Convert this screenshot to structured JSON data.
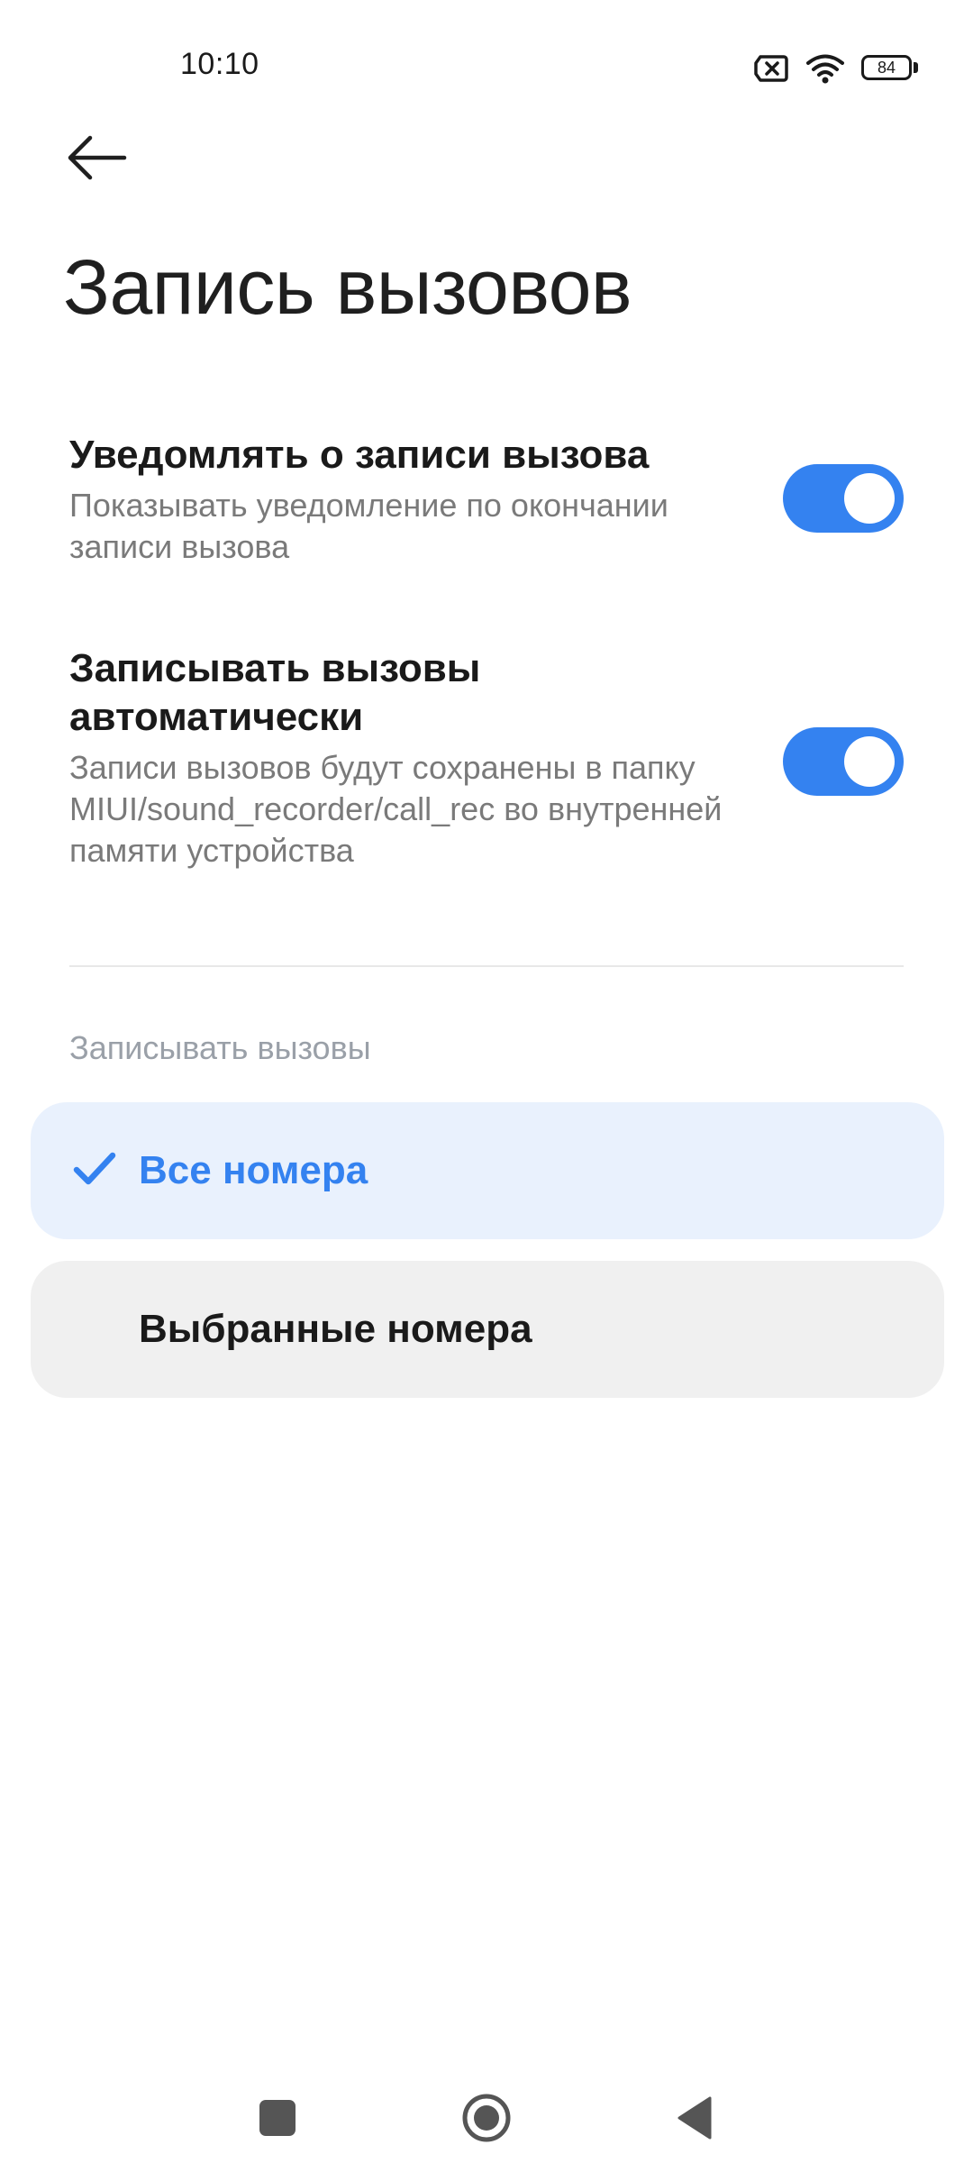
{
  "status_bar": {
    "time": "10:10",
    "battery_level": "84",
    "icons": [
      "sim-off-icon",
      "wifi-icon",
      "battery-icon"
    ]
  },
  "header": {
    "back_icon": "arrow-left-icon",
    "title": "Запись вызовов"
  },
  "settings": [
    {
      "title": "Уведомлять о записи вызова",
      "description": "Показывать уведомление по окончании записи вызова",
      "enabled": true
    },
    {
      "title": "Записывать вызовы автоматически",
      "description": "Записи вызовов будут сохранены в папку MIUI/sound_recorder/call_rec во внутренней памяти устройства",
      "enabled": true
    }
  ],
  "record_section": {
    "label": "Записывать вызовы",
    "options": [
      {
        "label": "Все номера",
        "selected": true
      },
      {
        "label": "Выбранные номера",
        "selected": false
      }
    ]
  },
  "nav_bar": {
    "buttons": [
      "recents-icon",
      "home-icon",
      "back-triangle-icon"
    ]
  },
  "colors": {
    "accent": "#3482f0",
    "selected_bg": "#e9f1fd",
    "unselected_bg": "#f0f0f0",
    "secondary_text": "#7a7a7a"
  }
}
